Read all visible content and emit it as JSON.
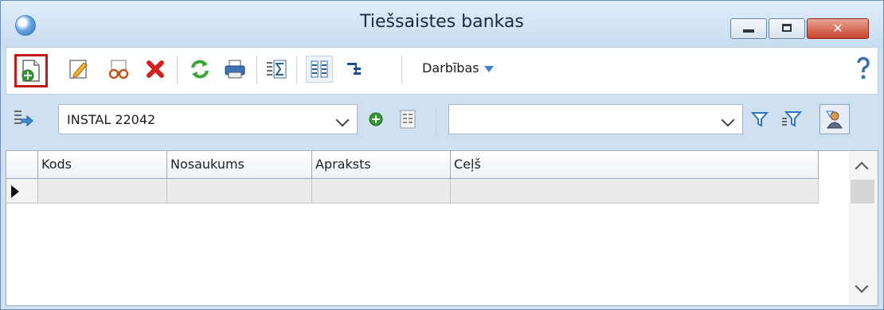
{
  "window": {
    "title": "Tiešsaistes bankas"
  },
  "titlebar_buttons": {
    "minimize": "minimize-icon",
    "maximize": "maximize-icon",
    "close": "close-icon"
  },
  "toolbar": {
    "icons": [
      "new-record-icon",
      "edit-icon",
      "view-icon",
      "delete-icon",
      "refresh-icon",
      "print-icon",
      "sum-icon",
      "columns-icon",
      "hierarchy-icon",
      "help-icon"
    ],
    "actions_label": "Darbības",
    "accent": "#3c7fd4",
    "highlight": "#c41919"
  },
  "filterbar": {
    "bank_select_value": "INSTAL 22042",
    "filter_select_value": ""
  },
  "grid": {
    "columns": [
      "Kods",
      "Nosaukums",
      "Apraksts",
      "Ceļš"
    ],
    "rows": [
      [
        "",
        "",
        "",
        ""
      ]
    ]
  }
}
